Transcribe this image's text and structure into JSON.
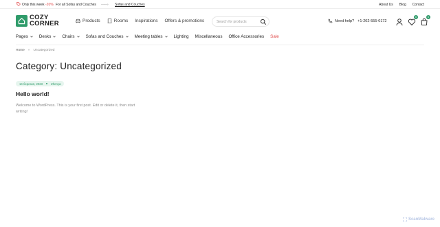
{
  "topbar": {
    "promo_prefix": "Only this week",
    "promo_discount": "-20%",
    "promo_suffix": "For all Sofas and Couches",
    "promo_arrow": "——›",
    "promo_link": "Sofas and Couches",
    "links": [
      "About Us",
      "Blog",
      "Contact"
    ]
  },
  "header": {
    "logo_line1": "COZY",
    "logo_line2": "CORNER",
    "nav": [
      {
        "label": "Products",
        "icon": "sofa-icon"
      },
      {
        "label": "Rooms",
        "icon": "door-icon"
      },
      {
        "label": "Inspirations"
      },
      {
        "label": "Offers & promotions"
      }
    ],
    "search_placeholder": "Search for products",
    "help_label": "Need help?",
    "help_phone": "+1-202-555-0172",
    "wishlist_count": "0",
    "cart_count": "0"
  },
  "categories": [
    {
      "label": "Pages",
      "dropdown": true
    },
    {
      "label": "Desks",
      "dropdown": true
    },
    {
      "label": "Chairs",
      "dropdown": true
    },
    {
      "label": "Sofas and Couches",
      "dropdown": true
    },
    {
      "label": "Meeting tables",
      "dropdown": true
    },
    {
      "label": "Lighting",
      "dropdown": false
    },
    {
      "label": "Miscellaneous",
      "dropdown": false
    },
    {
      "label": "Office Accessories",
      "dropdown": false
    },
    {
      "label": "Sale",
      "dropdown": false
    }
  ],
  "breadcrumb": {
    "home": "Home",
    "separator": "»",
    "current": "Uncategorized"
  },
  "main": {
    "page_title": "Category: Uncategorized",
    "post": {
      "date": "14 березня, 2023",
      "author": "Zhenya",
      "title": "Hello world!",
      "excerpt": "Welcome to WordPress. This is your first post. Edit or delete it, then start writing!"
    }
  },
  "watermark": "ScanMalware",
  "colors": {
    "accent": "#2f9b6a",
    "sale": "#e14b4b",
    "meta_bg": "#e6f5ee"
  }
}
